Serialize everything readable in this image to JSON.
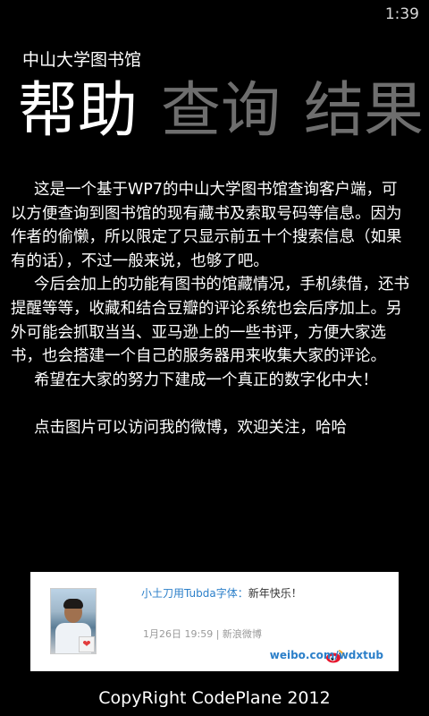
{
  "status_bar": {
    "time": "1:39"
  },
  "app": {
    "title": "中山大学图书馆"
  },
  "pivot": {
    "items": [
      {
        "label": "帮助",
        "active": true
      },
      {
        "label": "查询",
        "active": false
      },
      {
        "label": "结果",
        "active": false
      }
    ]
  },
  "help": {
    "paragraphs": [
      "这是一个基于WP7的中山大学图书馆查询客户端，可以方便查询到图书馆的现有藏书及索取号码等信息。因为作者的偷懒，所以限定了只显示前五十个搜索信息（如果有的话），不过一般来说，也够了吧。",
      "今后会加上的功能有图书的馆藏情况，手机续借，还书提醒等等，收藏和结合豆瓣的评论系统也会后序加上。另外可能会抓取当当、亚马逊上的一些书评，方便大家选书，也会搭建一个自己的服务器用来收集大家的评论。",
      "希望在大家的努力下建成一个真正的数字化中大！"
    ],
    "link_hint": "点击图片可以访问我的微博，欢迎关注，哈哈"
  },
  "weibo_card": {
    "user": "小土刀用Tubda字体：",
    "message": "新年快乐！",
    "meta": "1月26日  19:59 | 新浪微博",
    "url": "weibo.com/wdxtub"
  },
  "footer": {
    "copyright": "CopyRight CodePlane 2012"
  }
}
